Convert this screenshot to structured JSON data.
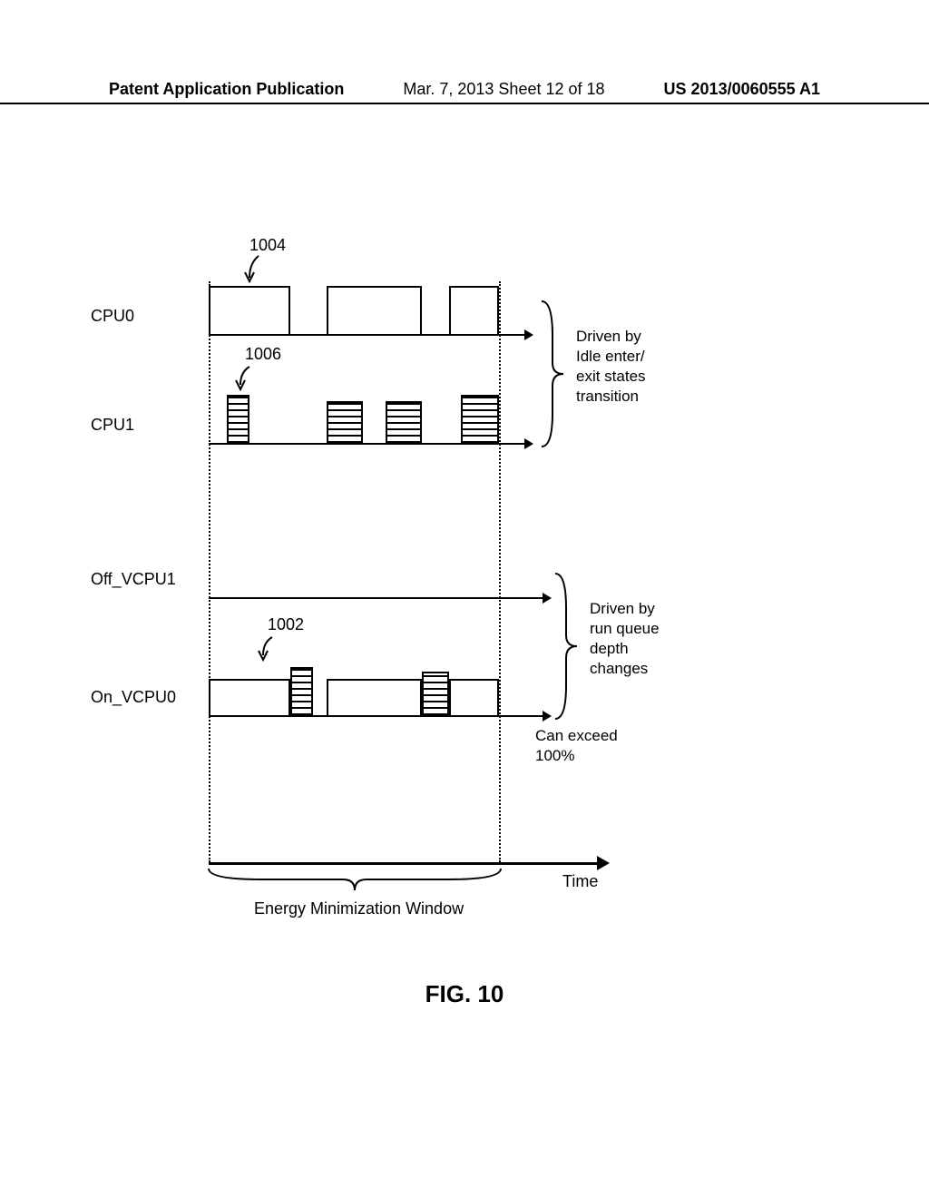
{
  "header": {
    "left": "Patent Application Publication",
    "center": "Mar. 7, 2013  Sheet 12 of 18",
    "right": "US 2013/0060555 A1"
  },
  "rows": {
    "cpu0": {
      "label": "CPU0"
    },
    "cpu1": {
      "label": "CPU1"
    },
    "off_vcpu1": {
      "label": "Off_VCPU1"
    },
    "on_vcpu0": {
      "label": "On_VCPU0"
    }
  },
  "refs": {
    "r1004": "1004",
    "r1006": "1006",
    "r1002": "1002"
  },
  "annotations": {
    "idle": "Driven by\nIdle enter/\nexit states\ntransition",
    "runqueue": "Driven by\nrun queue\ndepth\nchanges",
    "exceed": "Can exceed\n100%",
    "window": "Energy Minimization Window",
    "time": "Time"
  },
  "figure": "FIG. 10"
}
